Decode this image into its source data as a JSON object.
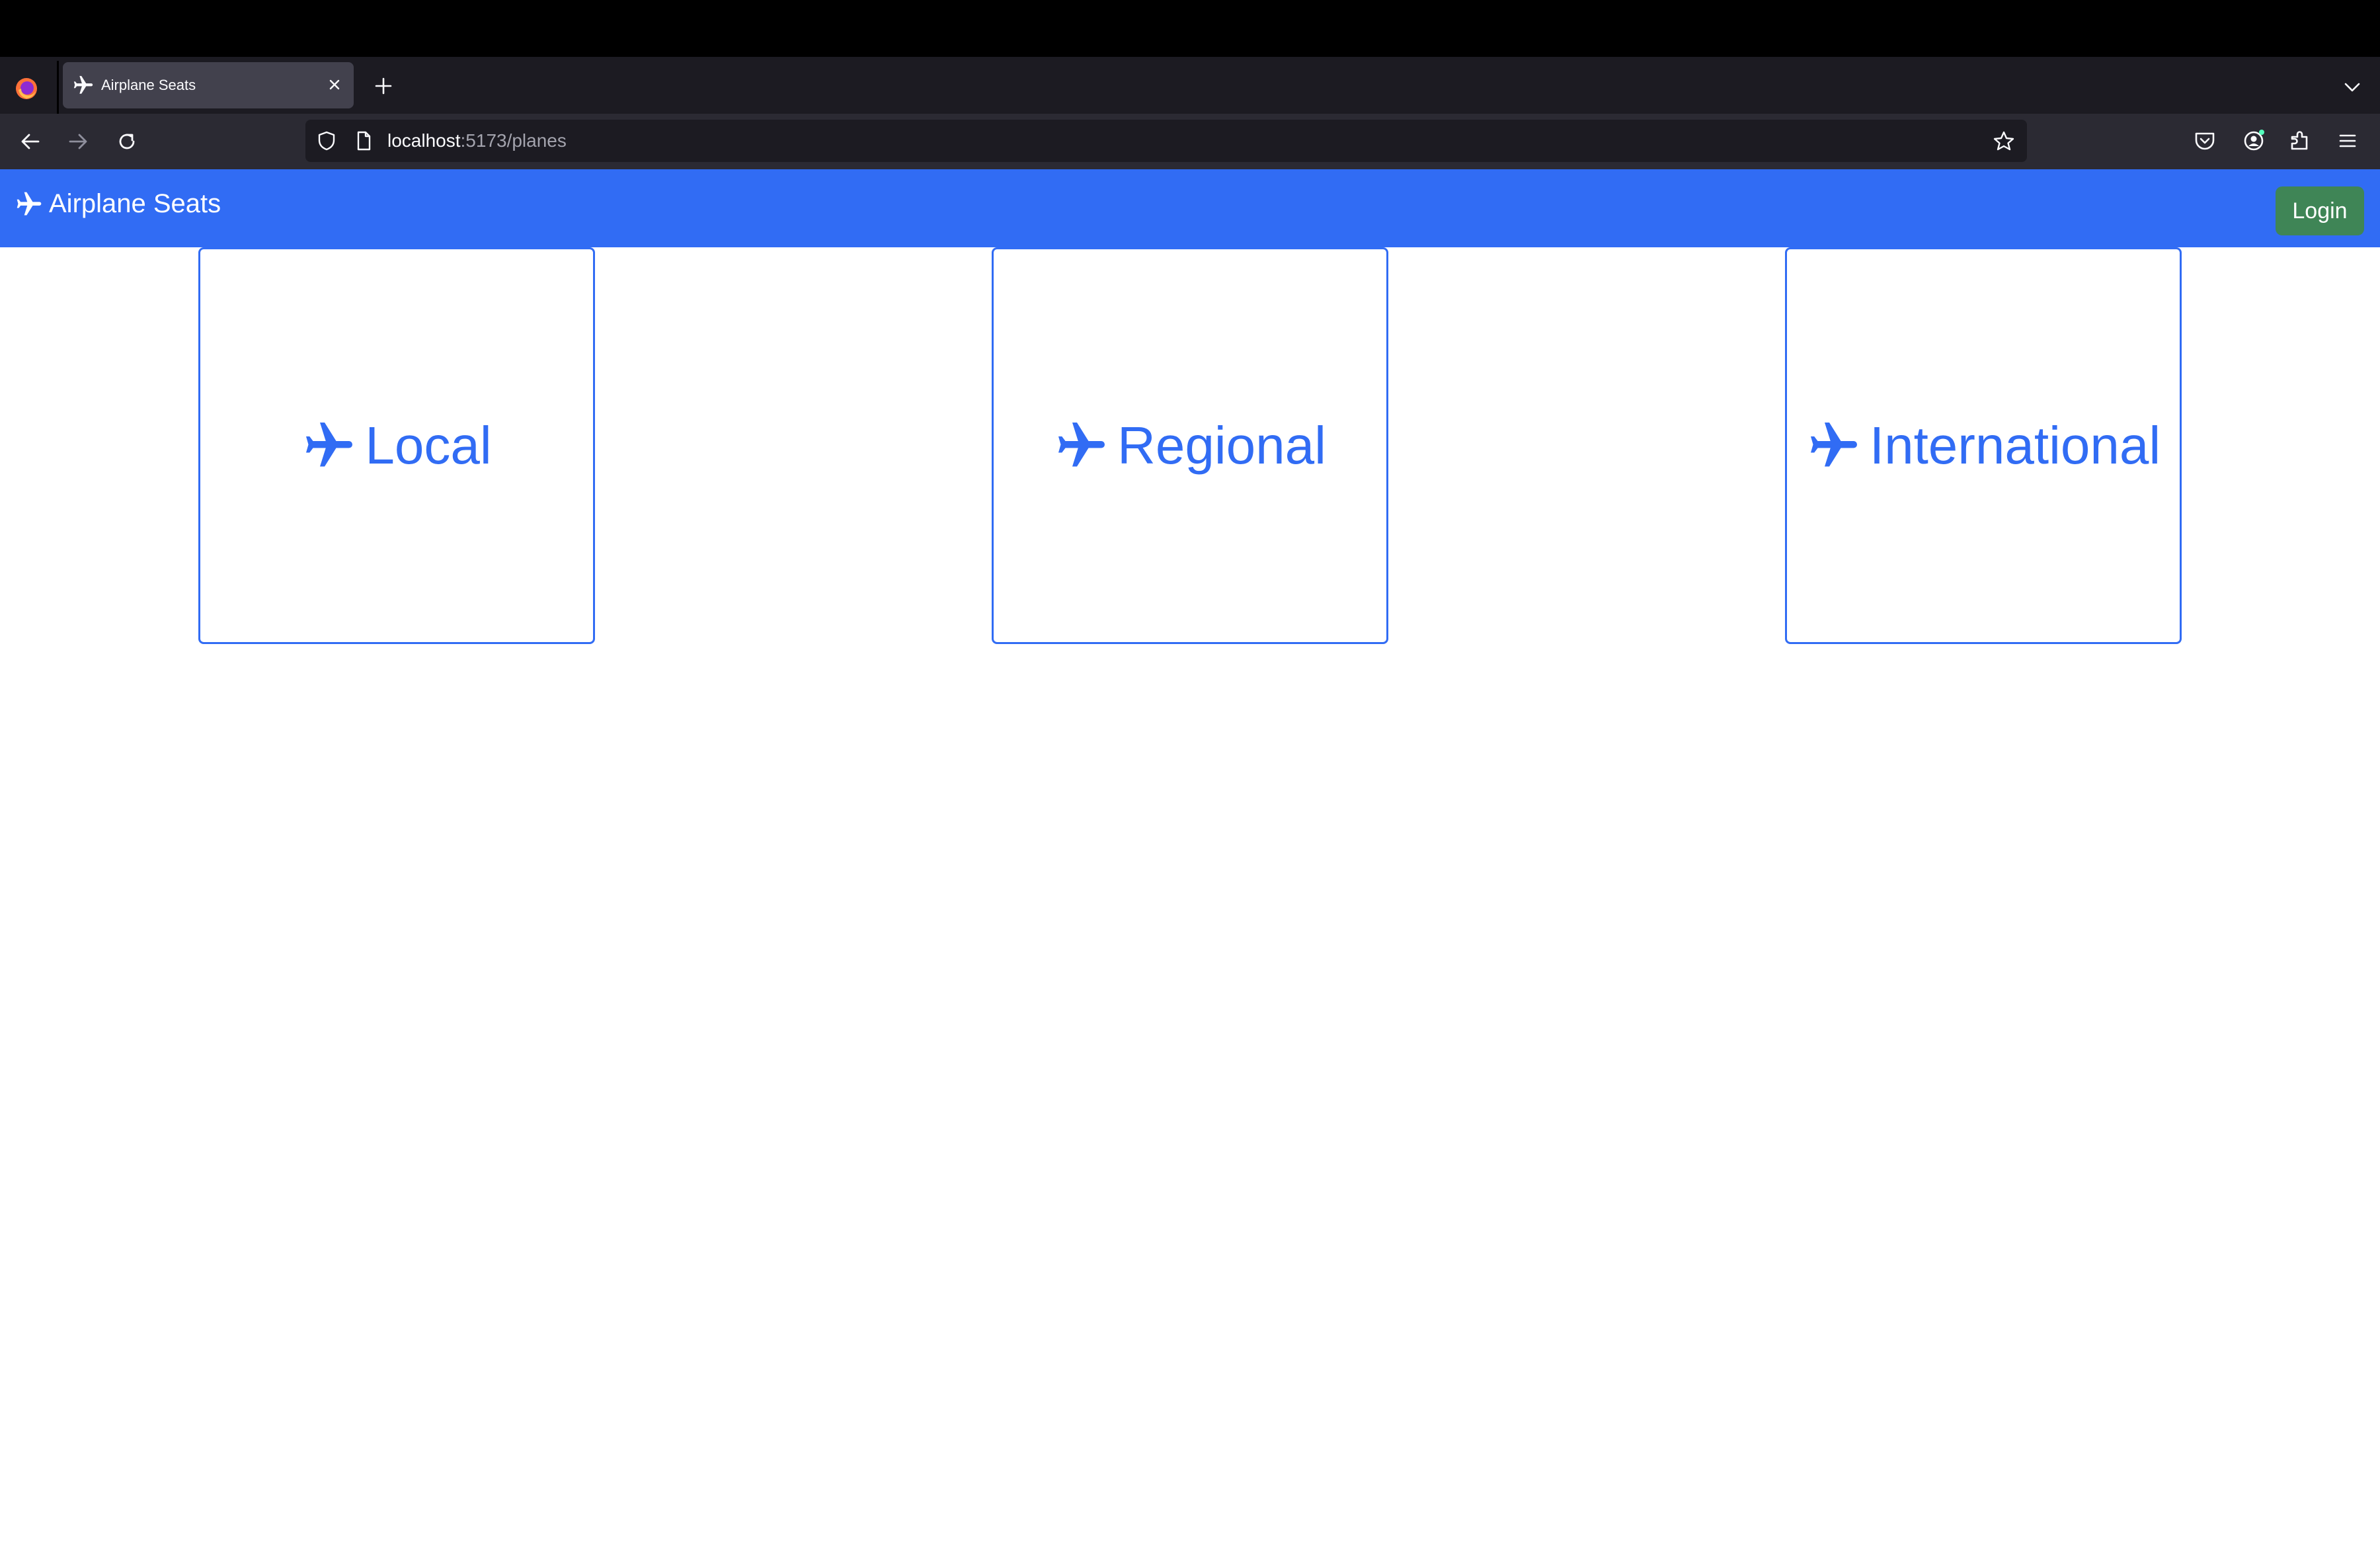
{
  "browser": {
    "tab": {
      "title": "Airplane Seats",
      "icon": "airplane-icon"
    },
    "address": {
      "host": "localhost",
      "path": ":5173/planes"
    },
    "icons": {
      "firefox": "firefox-logo",
      "new_tab": "plus-icon",
      "tab_list": "chevron-down-icon",
      "back": "arrow-left-icon",
      "forward": "arrow-right-icon",
      "reload": "reload-icon",
      "shield": "shield-icon",
      "page": "page-icon",
      "bookmark": "star-icon",
      "pocket": "pocket-icon",
      "account": "account-icon",
      "extensions": "puzzle-icon",
      "menu": "hamburger-icon"
    }
  },
  "navbar": {
    "brand": "Airplane Seats",
    "login_label": "Login"
  },
  "plane_types": [
    {
      "label": "Local"
    },
    {
      "label": "Regional"
    },
    {
      "label": "International"
    }
  ],
  "colors": {
    "primary": "#316cf4",
    "success": "#3f8556",
    "chrome_dark": "#1c1b22",
    "chrome_toolbar": "#2b2a33",
    "tab_active": "#42414d"
  }
}
